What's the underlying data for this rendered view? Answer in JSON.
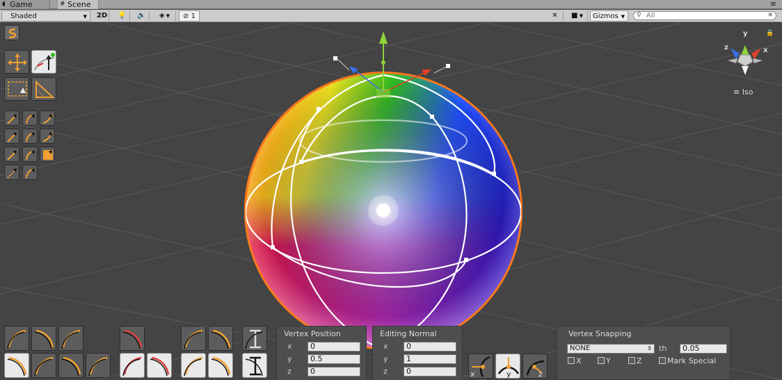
{
  "tabs": [
    {
      "label": "Game",
      "icon": "game-controller-icon"
    },
    {
      "label": "Scene",
      "icon": "scene-hash-icon"
    }
  ],
  "toolbar": {
    "shading_mode": "Shaded",
    "mode_2d": "2D",
    "hidden_count": "1",
    "gizmos_label": "Gizmos",
    "search_placeholder": "All"
  },
  "scene_gizmo": {
    "axes": [
      "y",
      "z",
      "x"
    ],
    "projection": "Iso"
  },
  "vertex_position": {
    "title": "Vertex Position",
    "x_label": "x",
    "y_label": "y",
    "z_label": "z",
    "x": "0",
    "y": "0.5",
    "z": "0"
  },
  "editing_normal": {
    "title": "Editing Normal",
    "x_label": "x",
    "y_label": "y",
    "z_label": "z",
    "x": "0",
    "y": "1",
    "z": "0"
  },
  "vertex_snapping": {
    "title": "Vertex Snapping",
    "mode": "NONE",
    "threshold_label": "th",
    "threshold": "0.05",
    "x_label": "X",
    "y_label": "Y",
    "z_label": "Z",
    "mark_special_label": "Mark Special"
  },
  "bottom_axis_labels": {
    "x": "x",
    "y": "y",
    "z": "z"
  },
  "colors": {
    "accent_orange": "#f0a030",
    "selection_outline": "#ff7a1a",
    "axis_x": "#e0402a",
    "axis_y": "#8fd23a",
    "axis_z": "#3a6ee8"
  }
}
